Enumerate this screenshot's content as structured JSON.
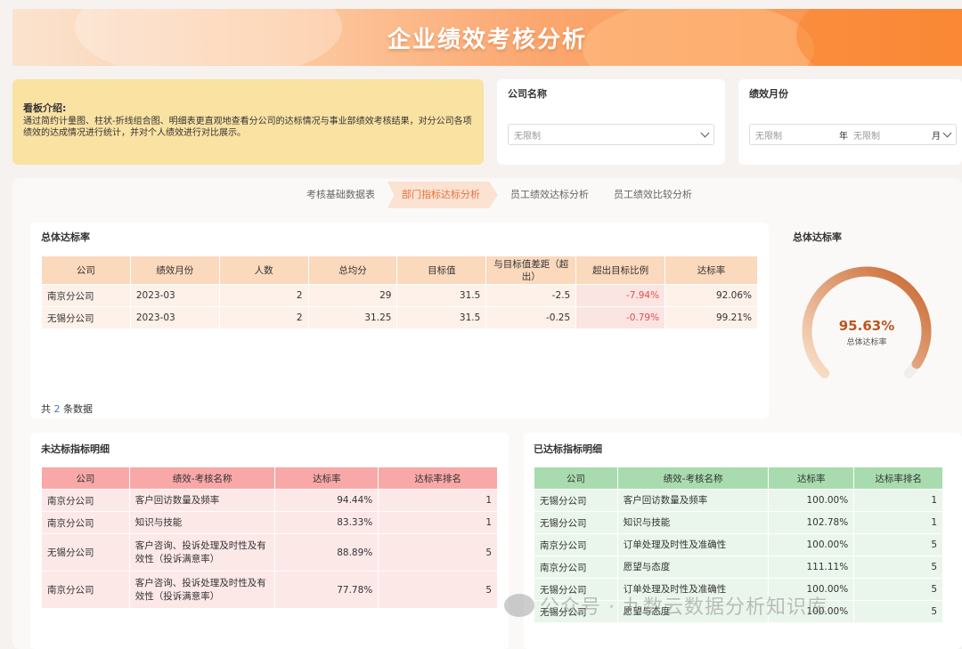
{
  "header": {
    "title": "企业绩效考核分析"
  },
  "intro": {
    "heading": "看板介绍:",
    "text": "通过简约计量图、柱状-折线组合图、明细表更直观地查看分公司的达标情况与事业部绩效考核结果，对分公司各项绩效的达成情况进行统计，并对个人绩效进行对比展示。"
  },
  "filters": {
    "company": {
      "label": "公司名称",
      "value": "无限制"
    },
    "month": {
      "label": "绩效月份",
      "year_value": "无限制",
      "year_unit": "年",
      "month_value": "无限制",
      "month_unit": "月"
    }
  },
  "tabs": [
    {
      "label": "考核基础数据表",
      "active": false
    },
    {
      "label": "部门指标达标分析",
      "active": true
    },
    {
      "label": "员工绩效达标分析",
      "active": false
    },
    {
      "label": "员工绩效比较分析",
      "active": false
    }
  ],
  "overall": {
    "title": "总体达标率",
    "columns": [
      "公司",
      "绩效月份",
      "人数",
      "总均分",
      "目标值",
      "与目标值差距（超出）",
      "超出目标比例",
      "达标率"
    ],
    "rows": [
      [
        "南京分公司",
        "2023-03",
        "2",
        "29",
        "31.5",
        "-2.5",
        "-7.94%",
        "92.06%"
      ],
      [
        "无锡分公司",
        "2023-03",
        "2",
        "31.25",
        "31.5",
        "-0.25",
        "-0.79%",
        "99.21%"
      ]
    ],
    "footer_prefix": "共",
    "footer_count": "2",
    "footer_suffix": "条数据"
  },
  "gauge": {
    "title": "总体达标率",
    "value_text": "95.63%",
    "label": "总体达标率",
    "value": 0.9563,
    "colors": {
      "start": "#f8d6b8",
      "end": "#c8642c",
      "track": "#eeeeee"
    }
  },
  "unmet": {
    "title": "未达标指标明细",
    "columns": [
      "公司",
      "绩效-考核名称",
      "达标率",
      "达标率排名"
    ],
    "rows": [
      [
        "南京分公司",
        "客户回访数量及频率",
        "94.44%",
        "1"
      ],
      [
        "南京分公司",
        "知识与技能",
        "83.33%",
        "1"
      ],
      [
        "无锡分公司",
        "客户咨询、投诉处理及时性及有效性（投诉满意率）",
        "88.89%",
        "5"
      ],
      [
        "南京分公司",
        "客户咨询、投诉处理及时性及有效性（投诉满意率）",
        "77.78%",
        "5"
      ]
    ]
  },
  "met": {
    "title": "已达标指标明细",
    "columns": [
      "公司",
      "绩效-考核名称",
      "达标率",
      "达标率排名"
    ],
    "rows": [
      [
        "无锡分公司",
        "客户回访数量及频率",
        "100.00%",
        "1"
      ],
      [
        "无锡分公司",
        "知识与技能",
        "102.78%",
        "1"
      ],
      [
        "南京分公司",
        "订单处理及时性及准确性",
        "100.00%",
        "5"
      ],
      [
        "南京分公司",
        "愿望与态度",
        "111.11%",
        "5"
      ],
      [
        "无锡分公司",
        "订单处理及时性及准确性",
        "100.00%",
        "5"
      ],
      [
        "无锡分公司",
        "愿望与态度",
        "100.00%",
        "5"
      ]
    ]
  },
  "watermark": "公众号 · 九数云数据分析知识库"
}
